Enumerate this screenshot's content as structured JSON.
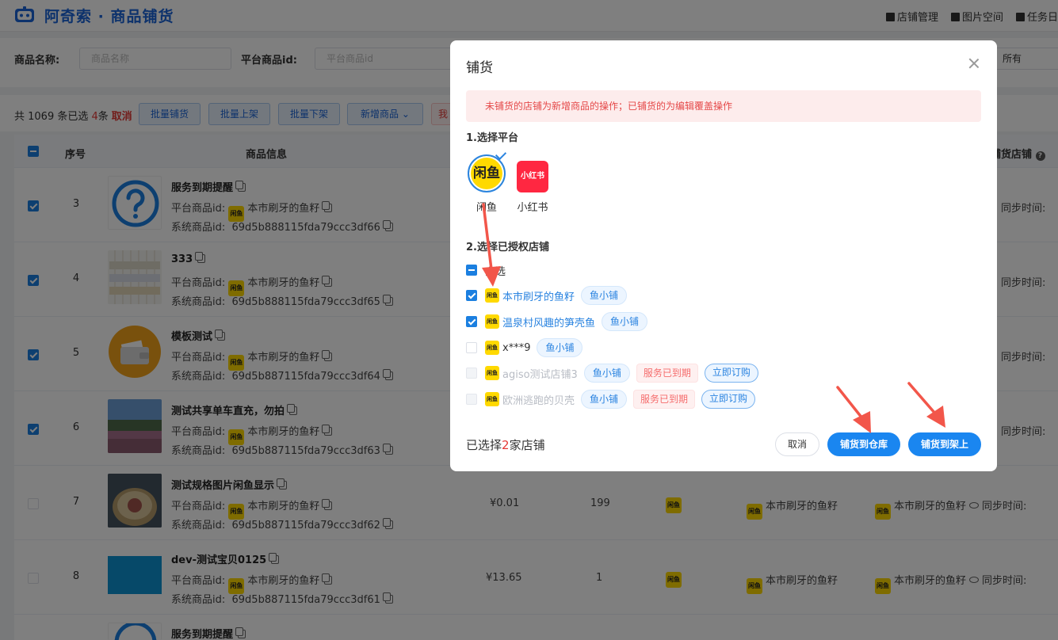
{
  "header": {
    "title": "阿奇索 · 商品铺货",
    "links": [
      "店铺管理",
      "图片空间",
      "任务日"
    ]
  },
  "filter": {
    "name_label": "商品名称:",
    "name_placeholder": "商品名称",
    "id_label": "平台商品id:",
    "id_placeholder": "平台商品id",
    "status_value": "所有"
  },
  "toolbar": {
    "count_prefix": "共 1069 条已选 ",
    "count_selected": "4",
    "count_suffix": "条",
    "cancel": "取消",
    "buttons": [
      "批量铺货",
      "批量上架",
      "批量下架",
      "新增商品"
    ],
    "red_button_partial": "我"
  },
  "table": {
    "headers": {
      "seq": "序号",
      "info": "商品信息",
      "shops": "铺货店铺"
    },
    "platform_id_label": "平台商品id:",
    "system_id_label": "系统商品id:",
    "sync_label": "同步时间:",
    "rows": [
      {
        "seq": "3",
        "name": "服务到期提醒",
        "shop": "本市刷牙的鱼籽",
        "sys_id": "69d5b888115fda79ccc3df66",
        "checked": true
      },
      {
        "seq": "4",
        "name": "333",
        "shop": "本市刷牙的鱼籽",
        "sys_id": "69d5b888115fda79ccc3df65",
        "checked": true
      },
      {
        "seq": "5",
        "name": "模板测试",
        "shop": "本市刷牙的鱼籽",
        "sys_id": "69d5b887115fda79ccc3df64",
        "checked": true
      },
      {
        "seq": "6",
        "name": "测试共享单车直充，勿拍",
        "shop": "本市刷牙的鱼籽",
        "sys_id": "69d5b887115fda79ccc3df63",
        "checked": true
      },
      {
        "seq": "7",
        "name": "测试规格图片闲鱼显示",
        "shop": "本市刷牙的鱼籽",
        "sys_id": "69d5b887115fda79ccc3df62",
        "checked": false,
        "price": "¥0.01",
        "stock": "199",
        "shop2": "本市刷牙的鱼籽",
        "shop3": "本市刷牙的鱼籽"
      },
      {
        "seq": "8",
        "name": "dev-测试宝贝0125",
        "shop": "本市刷牙的鱼籽",
        "sys_id": "69d5b887115fda79ccc3df61",
        "checked": false,
        "price": "¥13.65",
        "stock": "1",
        "shop2": "本市刷牙的鱼籽",
        "shop3": "本市刷牙的鱼籽"
      },
      {
        "seq": "",
        "name": "服务到期提醒"
      }
    ]
  },
  "dialog": {
    "title": "铺货",
    "alert": "未铺货的店铺为新增商品的操作；已铺货的为编辑覆盖操作",
    "section1": "1.选择平台",
    "platforms": [
      {
        "label": "闲鱼",
        "icon_text": "闲鱼",
        "selected": true
      },
      {
        "label": "小红书",
        "icon_text": "小红书",
        "selected": false
      }
    ],
    "section2": "2.选择已授权店铺",
    "select_all": "全选",
    "shops": [
      {
        "name": "本市刷牙的鱼籽",
        "tag": "鱼小铺",
        "state": "checked"
      },
      {
        "name": "温泉村风趣的笋壳鱼",
        "tag": "鱼小铺",
        "state": "checked"
      },
      {
        "name": "x***9",
        "tag": "鱼小铺",
        "state": "unchecked"
      },
      {
        "name": "agiso测试店铺3",
        "tag": "鱼小铺",
        "expired": "服务已到期",
        "subscribe": "立即订购",
        "state": "disabled"
      },
      {
        "name": "欧洲逃跑的贝壳",
        "tag": "鱼小铺",
        "expired": "服务已到期",
        "subscribe": "立即订购",
        "state": "disabled"
      }
    ],
    "selected_prefix": "已选择",
    "selected_count": "2",
    "selected_suffix": "家店铺",
    "btn_cancel": "取消",
    "btn_warehouse": "铺货到仓库",
    "btn_shelf": "铺货到架上"
  },
  "icons": {
    "xianyu_badge": "闲鱼",
    "xy_small": "闲鱼"
  },
  "colors": {
    "primary": "#1a86f0",
    "danger": "#e53935",
    "xianyu": "#ffd900",
    "xiaohongshu": "#ff2741",
    "annotation_arrow": "#f2564a"
  }
}
